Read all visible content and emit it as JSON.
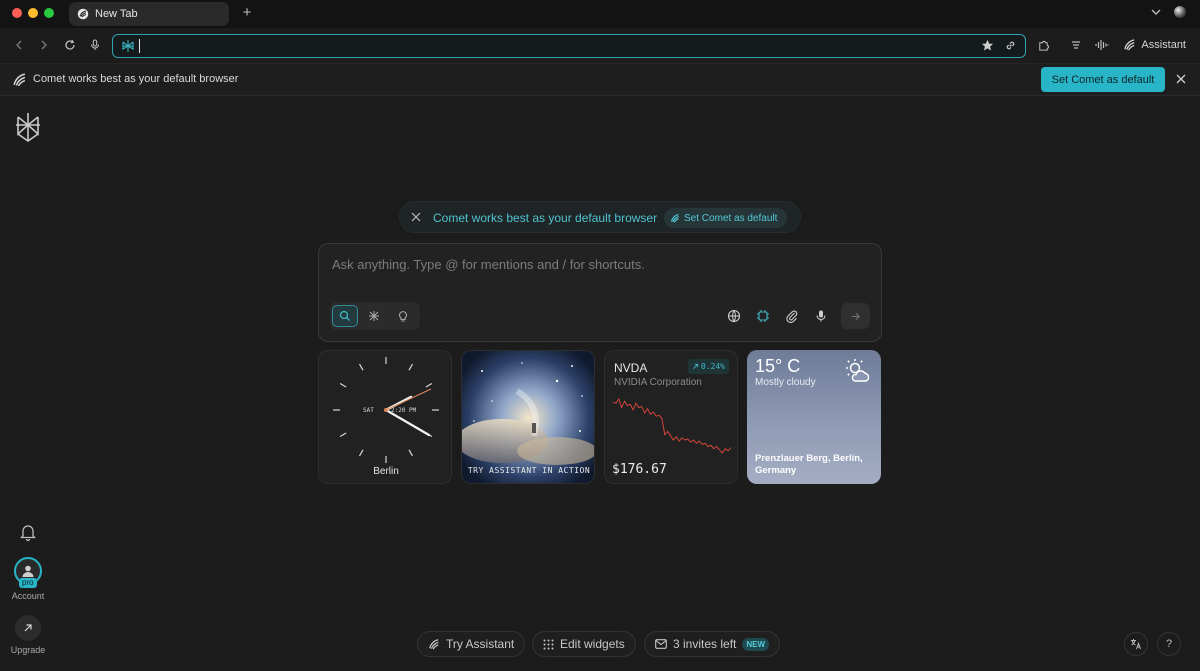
{
  "window": {
    "tab_title": "New Tab",
    "new_tab_glyph": "+"
  },
  "toolbar": {
    "assistant_label": "Assistant",
    "icons": [
      "back-icon",
      "forward-icon",
      "reload-icon",
      "microphone-icon",
      "comet-icon",
      "star-icon",
      "link-icon",
      "extensions-icon",
      "menu-icon",
      "voice-wave-icon"
    ]
  },
  "infobar": {
    "message": "Comet works best as your default browser",
    "button_label": "Set Comet as default"
  },
  "sidebar": {
    "account_label": "Account",
    "pro_badge": "pro",
    "upgrade_label": "Upgrade"
  },
  "banner": {
    "message": "Comet works best as your default browser",
    "button_label": "Set Comet as default"
  },
  "search": {
    "placeholder": "Ask anything. Type @ for mentions and / for shortcuts.",
    "modes": [
      "search",
      "research",
      "labs"
    ],
    "active_mode": "search"
  },
  "widgets": {
    "clock": {
      "city": "Berlin",
      "day": "SAT",
      "time": "2:20 PM"
    },
    "promo": {
      "caption": "TRY ASSISTANT IN ACTION"
    },
    "stock": {
      "ticker": "NVDA",
      "company": "NVIDIA Corporation",
      "change": "0.24%",
      "price": "$176.67",
      "trend_values": [
        85,
        84,
        88,
        80,
        86,
        82,
        83,
        78,
        84,
        80,
        81,
        75,
        79,
        74,
        76,
        72,
        73,
        70,
        55,
        58,
        54,
        50,
        53,
        49,
        52,
        50,
        51,
        48,
        50,
        47,
        49,
        46,
        47,
        44,
        45,
        42,
        44,
        41,
        38,
        42,
        40,
        43
      ]
    },
    "weather": {
      "temperature": "15° C",
      "condition": "Mostly cloudy",
      "location": "Prenzlauer Berg, Berlin, Germany"
    }
  },
  "footer": {
    "try_assistant": "Try Assistant",
    "edit_widgets": "Edit widgets",
    "invites": "3 invites left",
    "new_badge": "NEW",
    "help": "?"
  },
  "colors": {
    "accent": "#27b5c7",
    "background": "#1c1c1c",
    "stock_line": "#d0453a"
  }
}
